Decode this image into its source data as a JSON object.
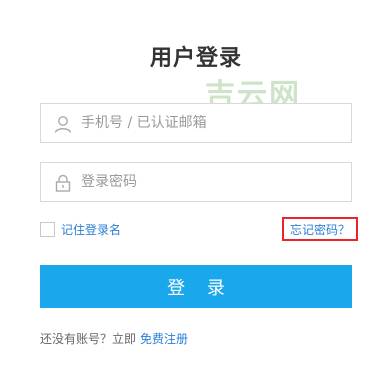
{
  "page_title": "用户登录",
  "watermark": "吉云网",
  "username": {
    "placeholder": "手机号 / 已认证邮箱",
    "icon": "user-icon"
  },
  "password": {
    "placeholder": "登录密码",
    "icon": "lock-icon"
  },
  "remember_label": "记住登录名",
  "forgot_label": "忘记密码？",
  "login_button": "登 录",
  "register_prompt": "还没有账号？立即",
  "register_link": "免费注册",
  "colors": {
    "primary": "#1ba7ec",
    "link": "#2a7fd4",
    "highlight_border": "#e8262a",
    "watermark": "#cfe3c9"
  }
}
